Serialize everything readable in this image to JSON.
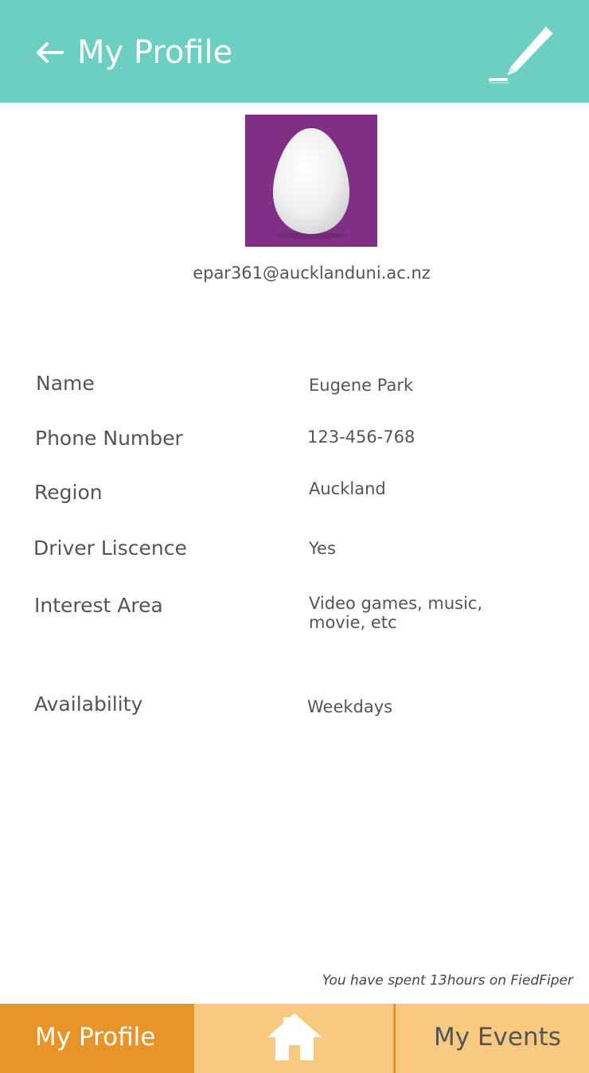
{
  "header": {
    "title": "My Profile",
    "back_icon": "arrow-left-icon",
    "edit_icon": "pencil-icon",
    "background": "#6ccfc1"
  },
  "profile": {
    "avatar_icon": "egg-avatar",
    "avatar_color": "#7f3084",
    "email": "epar361@aucklanduni.ac.nz"
  },
  "fields": {
    "name": {
      "label": "Name",
      "value": "Eugene Park"
    },
    "phone": {
      "label": "Phone Number",
      "value": "123-456-768"
    },
    "region": {
      "label": "Region",
      "value": "Auckland"
    },
    "licence": {
      "label": "Driver Liscence",
      "value": "Yes"
    },
    "interest": {
      "label": "Interest Area",
      "value_line1": "Video games, music,",
      "value_line2": "movie, etc"
    },
    "availability": {
      "label": "Availability",
      "value": "Weekdays"
    }
  },
  "footer_note": "You have spent 13hours on FiedFiper",
  "tabs": {
    "profile": "My Profile",
    "home_icon": "home-icon",
    "events": "My Events",
    "active_color": "#e89428",
    "inactive_color": "#f8c980"
  }
}
